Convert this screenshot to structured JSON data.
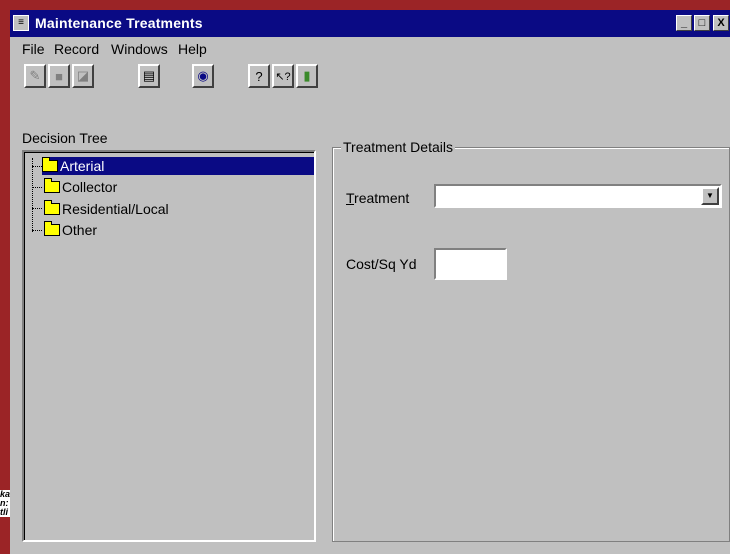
{
  "window": {
    "title": "Maintenance Treatments"
  },
  "title_buttons": {
    "minimize": "_",
    "maximize": "□",
    "close": "X"
  },
  "menu": [
    {
      "label": "File"
    },
    {
      "label": "Record"
    },
    {
      "label": "Windows"
    },
    {
      "label": "Help"
    }
  ],
  "toolbar": {
    "buttons": [
      {
        "icon": "pencil-icon",
        "glyph": "✎"
      },
      {
        "icon": "stop-icon",
        "glyph": "■"
      },
      {
        "icon": "edit-icon",
        "glyph": "◪"
      },
      {
        "icon": "document-icon",
        "glyph": "▤"
      },
      {
        "icon": "chat-icon",
        "glyph": "◉"
      },
      {
        "icon": "help-icon",
        "glyph": "?"
      },
      {
        "icon": "context-help-icon",
        "glyph": "↖?"
      },
      {
        "icon": "exit-door-icon",
        "glyph": "▮"
      }
    ]
  },
  "tree": {
    "label": "Decision Tree",
    "items": [
      {
        "label": "Arterial",
        "selected": true
      },
      {
        "label": "Collector"
      },
      {
        "label": "Residential/Local"
      },
      {
        "label": "Other"
      }
    ]
  },
  "details": {
    "group_title": "Treatment Details",
    "treatment_label": "Treatment",
    "treatment_value": "",
    "cost_label": "Cost/Sq Yd",
    "cost_value": ""
  },
  "side_fragment": "ka\nn:\ntli",
  "colors": {
    "titlebar": "#0a0a84",
    "background": "#9b2426",
    "face": "#c0c0c0"
  }
}
